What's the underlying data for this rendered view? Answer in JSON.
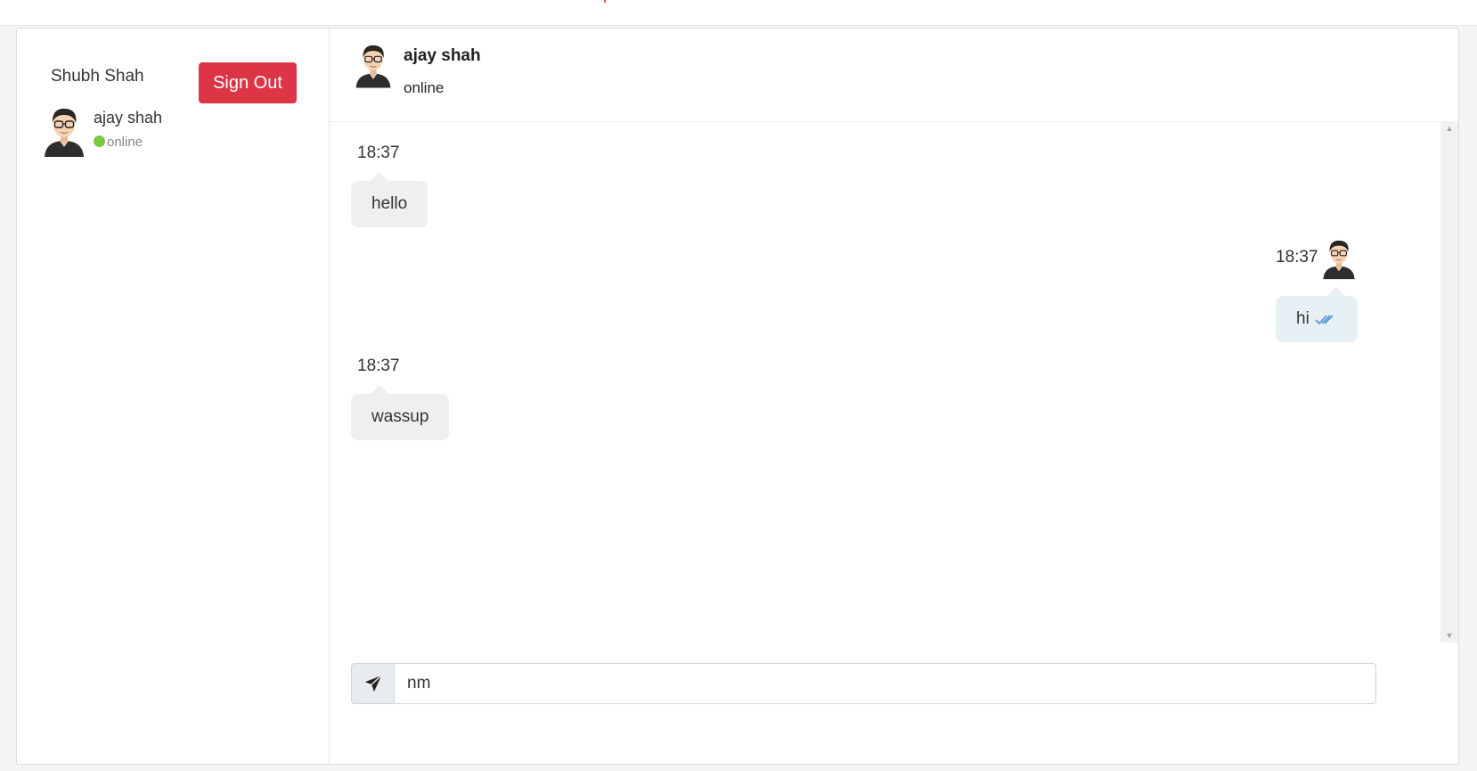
{
  "current_user": {
    "name": "Shubh Shah"
  },
  "sidebar": {
    "signout_label": "Sign Out",
    "contacts": [
      {
        "name": "ajay shah",
        "status": "online",
        "status_color": "#7ac943",
        "avatar_icon": "user-avatar-icon"
      }
    ]
  },
  "chat": {
    "peer": {
      "name": "ajay shah",
      "status": "online"
    },
    "messages": [
      {
        "direction": "incoming",
        "time": "18:37",
        "text": "hello"
      },
      {
        "direction": "outgoing",
        "time": "18:37",
        "text": "hi",
        "read_receipt_icon": "double-check-icon"
      },
      {
        "direction": "incoming",
        "time": "18:37",
        "text": "wassup"
      }
    ]
  },
  "composer": {
    "value": "nm",
    "send_icon": "paper-plane-icon"
  },
  "colors": {
    "signout": "#dc3545",
    "incoming_bubble": "#efefef",
    "outgoing_bubble": "#e7f0f4",
    "read_tick": "#4a90d9"
  }
}
